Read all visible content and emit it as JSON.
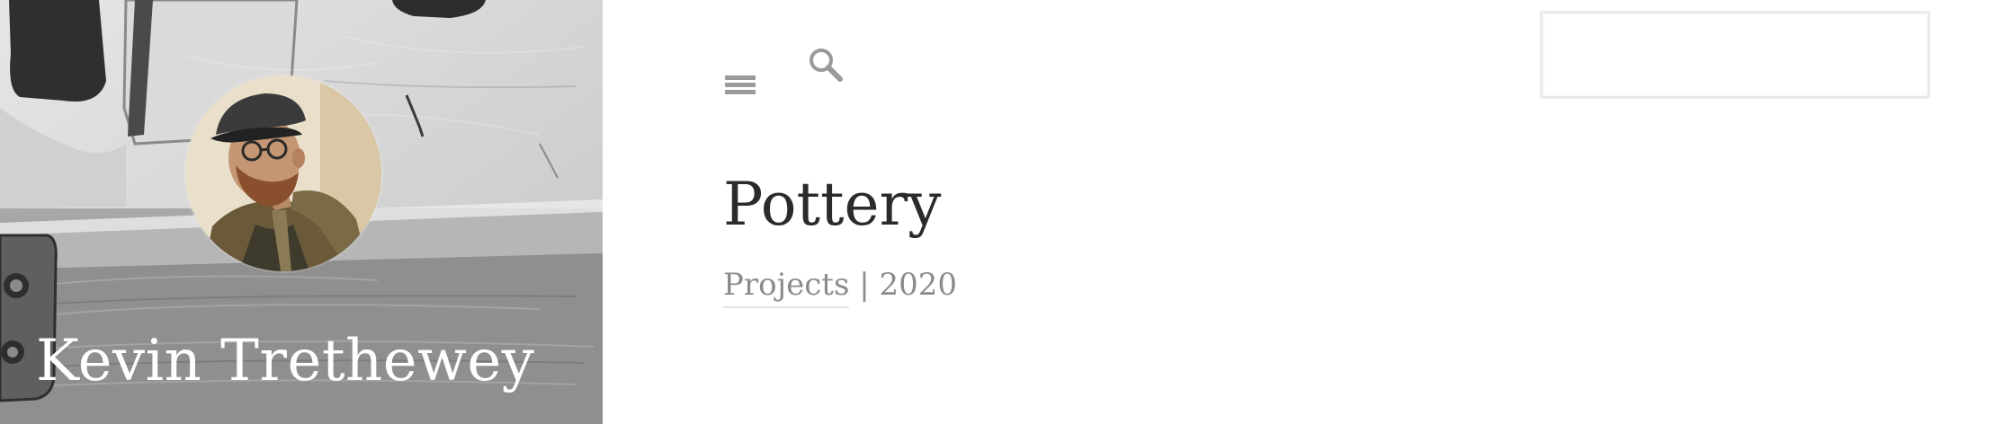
{
  "sidebar": {
    "author_name": "Kevin Trethewey"
  },
  "header": {
    "menu_icon": "hamburger-menu-icon",
    "search_icon": "magnifier-icon",
    "search_value": "",
    "search_placeholder": ""
  },
  "main": {
    "title": "Pottery",
    "category_link": "Projects",
    "separator": " | ",
    "year": "2020"
  },
  "colors": {
    "title_text": "#2b2b2b",
    "meta_text": "#8b8b8b",
    "icon_gray": "#9a9a9a",
    "hero_text": "#ffffff"
  }
}
